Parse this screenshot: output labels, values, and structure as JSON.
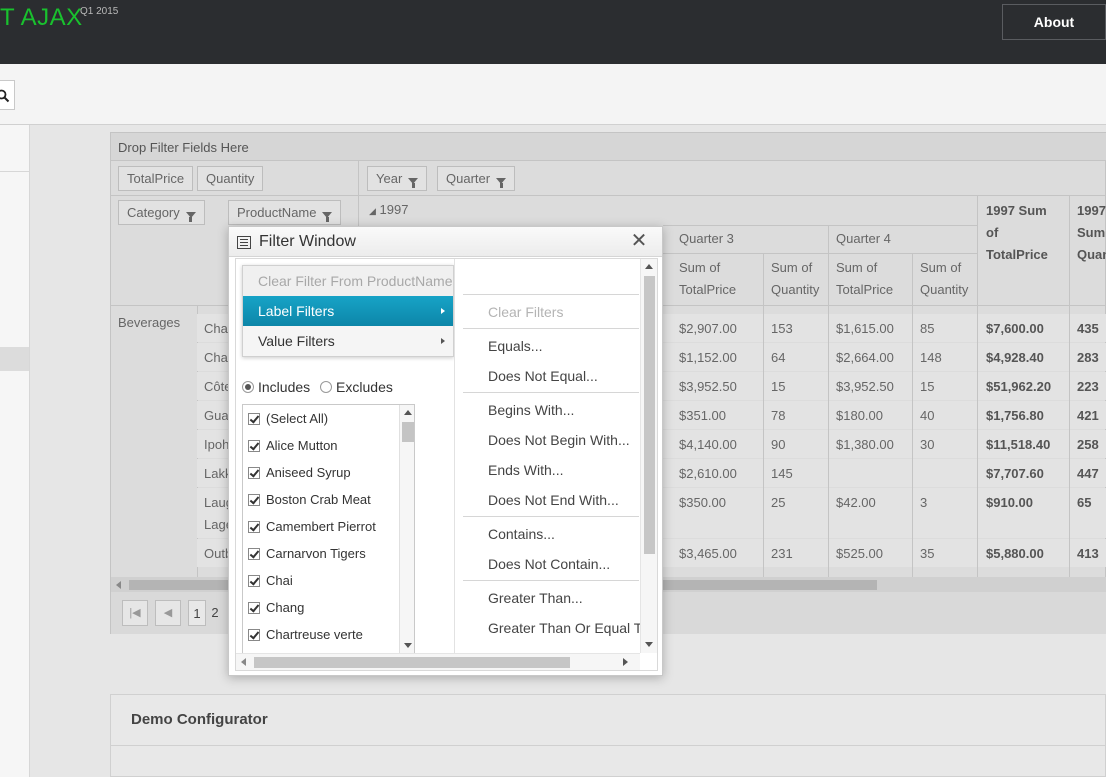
{
  "header": {
    "brand": "T AJAX",
    "brand_sub": "Q1 2015",
    "about_label": "About"
  },
  "icons": {
    "search": "search-icon",
    "window": "window-icon",
    "close": "close-icon",
    "funnel": "filter-funnel-icon",
    "first_page": "first-page-icon",
    "prev_page": "prev-page-icon"
  },
  "colors": {
    "brand": "#19c12e",
    "menu_active": "#0d97bd",
    "topbar": "#2b2d30"
  },
  "pivot": {
    "drop_filter": "Drop Filter Fields Here",
    "data_fields": [
      "TotalPrice",
      "Quantity"
    ],
    "column_fields": [
      "Year",
      "Quarter"
    ],
    "row_fields": [
      "Category",
      "ProductName"
    ],
    "year_label": "1997",
    "quarters": [
      "Quarter 3",
      "Quarter 4"
    ],
    "sum_total_price": [
      "Sum of",
      "TotalPrice"
    ],
    "sum_quantity": [
      "Sum of",
      "Quantity"
    ],
    "year_total_price": [
      "1997 Sum",
      "of",
      "TotalPrice"
    ],
    "year_total_qty": [
      "1997",
      "Sum",
      "Quan"
    ],
    "category": "Beverages",
    "rows": [
      {
        "name": "Cha",
        "q3p": "$2,907.00",
        "q3q": "153",
        "q4p": "$1,615.00",
        "q4q": "85",
        "tp": "$7,600.00",
        "tq": "435"
      },
      {
        "name": "Cha",
        "q3p": "$1,152.00",
        "q3q": "64",
        "q4p": "$2,664.00",
        "q4q": "148",
        "tp": "$4,928.40",
        "tq": "283"
      },
      {
        "name": "Côte",
        "q3p": "$3,952.50",
        "q3q": "15",
        "q4p": "$3,952.50",
        "q4q": "15",
        "tp": "$51,962.20",
        "tq": "223"
      },
      {
        "name": "Gua",
        "q3p": "$351.00",
        "q3q": "78",
        "q4p": "$180.00",
        "q4q": "40",
        "tp": "$1,756.80",
        "tq": "421"
      },
      {
        "name": "Ipoh",
        "q3p": "$4,140.00",
        "q3q": "90",
        "q4p": "$1,380.00",
        "q4q": "30",
        "tp": "$11,518.40",
        "tq": "258"
      },
      {
        "name": "Lakk",
        "q3p": "$2,610.00",
        "q3q": "145",
        "q4p": "",
        "q4q": "",
        "tp": "$7,707.60",
        "tq": "447"
      },
      {
        "name": "Laug",
        "name2": "Lage",
        "q3p": "$350.00",
        "q3q": "25",
        "q4p": "$42.00",
        "q4q": "3",
        "tp": "$910.00",
        "tq": "65"
      },
      {
        "name": "Outb",
        "q3p": "$3,465.00",
        "q3q": "231",
        "q4p": "$525.00",
        "q4q": "35",
        "tp": "$5,880.00",
        "tq": "413"
      }
    ],
    "pages": [
      "1",
      "2"
    ]
  },
  "filter_window": {
    "title": "Filter Window",
    "menu": {
      "clear": "Clear Filter From ProductName",
      "label_filters": "Label Filters",
      "value_filters": "Value Filters"
    },
    "includes": "Includes",
    "excludes": "Excludes",
    "items": [
      "(Select All)",
      "Alice Mutton",
      "Aniseed Syrup",
      "Boston Crab Meat",
      "Camembert Pierrot",
      "Carnarvon Tigers",
      "Chai",
      "Chang",
      "Chartreuse verte"
    ],
    "submenu": {
      "clear": "Clear Filters",
      "equals": "Equals...",
      "not_equal": "Does Not Equal...",
      "begins": "Begins With...",
      "not_begin": "Does Not Begin With...",
      "ends": "Ends With...",
      "not_end": "Does Not End With...",
      "contains": "Contains...",
      "not_contain": "Does Not Contain...",
      "greater": "Greater Than...",
      "greater_equal": "Greater Than Or Equal To..."
    }
  },
  "demo": {
    "title": "Demo Configurator"
  }
}
